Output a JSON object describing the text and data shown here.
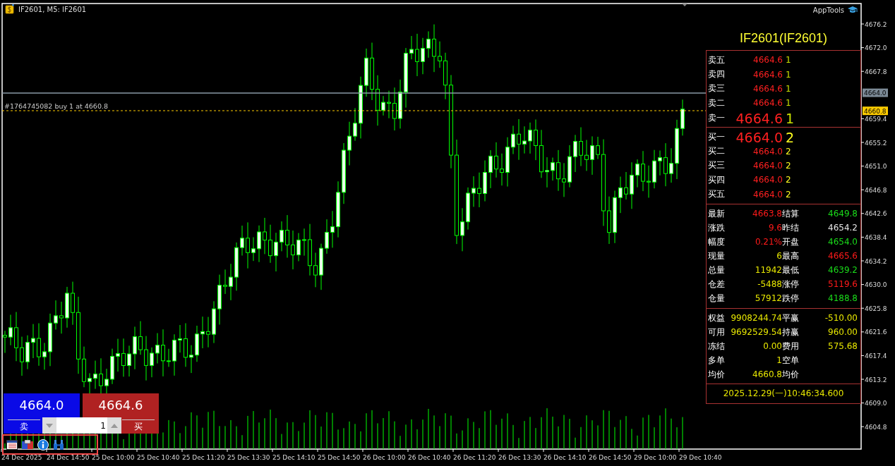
{
  "chart": {
    "title": "IF2601, M5:  IF2601",
    "brand": "AppTools",
    "order_line": "#1764745082 buy 1 at 4660.8",
    "price_axis": [
      "4676.2",
      "4672.0",
      "4667.8",
      "4659.4",
      "4655.2",
      "4651.0",
      "4646.8",
      "4642.6",
      "4638.4",
      "4634.2",
      "4630.0",
      "4625.8",
      "4621.6",
      "4617.4",
      "4613.2",
      "4609.0",
      "4604.8"
    ],
    "price_tags": [
      {
        "label": "4664.0",
        "kind": "bid"
      },
      {
        "label": "4660.8",
        "kind": "order"
      }
    ],
    "time_axis": [
      "24 Dec 2025",
      "24 Dec 14:50",
      "25 Dec 10:00",
      "25 Dec 10:40",
      "25 Dec 11:20",
      "25 Dec 13:30",
      "25 Dec 14:10",
      "25 Dec 14:50",
      "26 Dec 10:00",
      "26 Dec 10:40",
      "26 Dec 11:20",
      "26 Dec 13:30",
      "26 Dec 14:10",
      "26 Dec 14:50",
      "29 Dec 10:00",
      "29 Dec 10:40"
    ]
  },
  "quote_panel": {
    "title": "IF2601(IF2601)",
    "asks": [
      {
        "label": "卖五",
        "price": "4664.6",
        "qty": "1",
        "best": false
      },
      {
        "label": "卖四",
        "price": "4664.6",
        "qty": "1",
        "best": false
      },
      {
        "label": "卖三",
        "price": "4664.6",
        "qty": "1",
        "best": false
      },
      {
        "label": "卖二",
        "price": "4664.6",
        "qty": "1",
        "best": false
      },
      {
        "label": "卖一",
        "price": "4664.6",
        "qty": "1",
        "best": true
      }
    ],
    "bids": [
      {
        "label": "买一",
        "price": "4664.0",
        "qty": "2",
        "best": true
      },
      {
        "label": "买二",
        "price": "4664.0",
        "qty": "2",
        "best": false
      },
      {
        "label": "买三",
        "price": "4664.0",
        "qty": "2",
        "best": false
      },
      {
        "label": "买四",
        "price": "4664.0",
        "qty": "2",
        "best": false
      },
      {
        "label": "买五",
        "price": "4664.0",
        "qty": "2",
        "best": false
      }
    ],
    "stats": [
      {
        "label": "最新",
        "value": "4663.8",
        "color": "#ff1a1a"
      },
      {
        "label": "结算",
        "value": "4649.8",
        "color": "#1adc1a"
      },
      {
        "label": "涨跌",
        "value": "9.6",
        "color": "#ff1a1a"
      },
      {
        "label": "昨结",
        "value": "4654.2",
        "color": "#e6e6e6"
      },
      {
        "label": "幅度",
        "value": "0.21%",
        "color": "#ff1a1a"
      },
      {
        "label": "开盘",
        "value": "4654.0",
        "color": "#1adc1a"
      },
      {
        "label": "现量",
        "value": "6",
        "color": "#e6e600"
      },
      {
        "label": "最高",
        "value": "4665.6",
        "color": "#ff1a1a"
      },
      {
        "label": "总量",
        "value": "11942",
        "color": "#e6e600"
      },
      {
        "label": "最低",
        "value": "4639.2",
        "color": "#1adc1a"
      },
      {
        "label": "仓差",
        "value": "-5488",
        "color": "#e6e600"
      },
      {
        "label": "涨停",
        "value": "5119.6",
        "color": "#ff1a1a"
      },
      {
        "label": "仓量",
        "value": "57912",
        "color": "#e6e600"
      },
      {
        "label": "跌停",
        "value": "4188.8",
        "color": "#1adc1a"
      }
    ],
    "account": [
      {
        "label": "权益",
        "value": "9908244.74"
      },
      {
        "label": "平赢",
        "value": "-510.00"
      },
      {
        "label": "可用",
        "value": "9692529.54"
      },
      {
        "label": "持赢",
        "value": "960.00"
      },
      {
        "label": "冻结",
        "value": "0.00"
      },
      {
        "label": "费用",
        "value": "575.68"
      },
      {
        "label": "多单",
        "value": "1"
      },
      {
        "label": "空单"
      },
      {
        "label": "均价",
        "value": "4660.8"
      },
      {
        "label": "均价"
      }
    ],
    "time": "2025.12.29(一)10:46:34.600"
  },
  "trade_panel": {
    "sell": {
      "price": "4664.0",
      "label": "卖"
    },
    "buy": {
      "price": "4664.6",
      "label": "买"
    },
    "volume": "1"
  }
}
